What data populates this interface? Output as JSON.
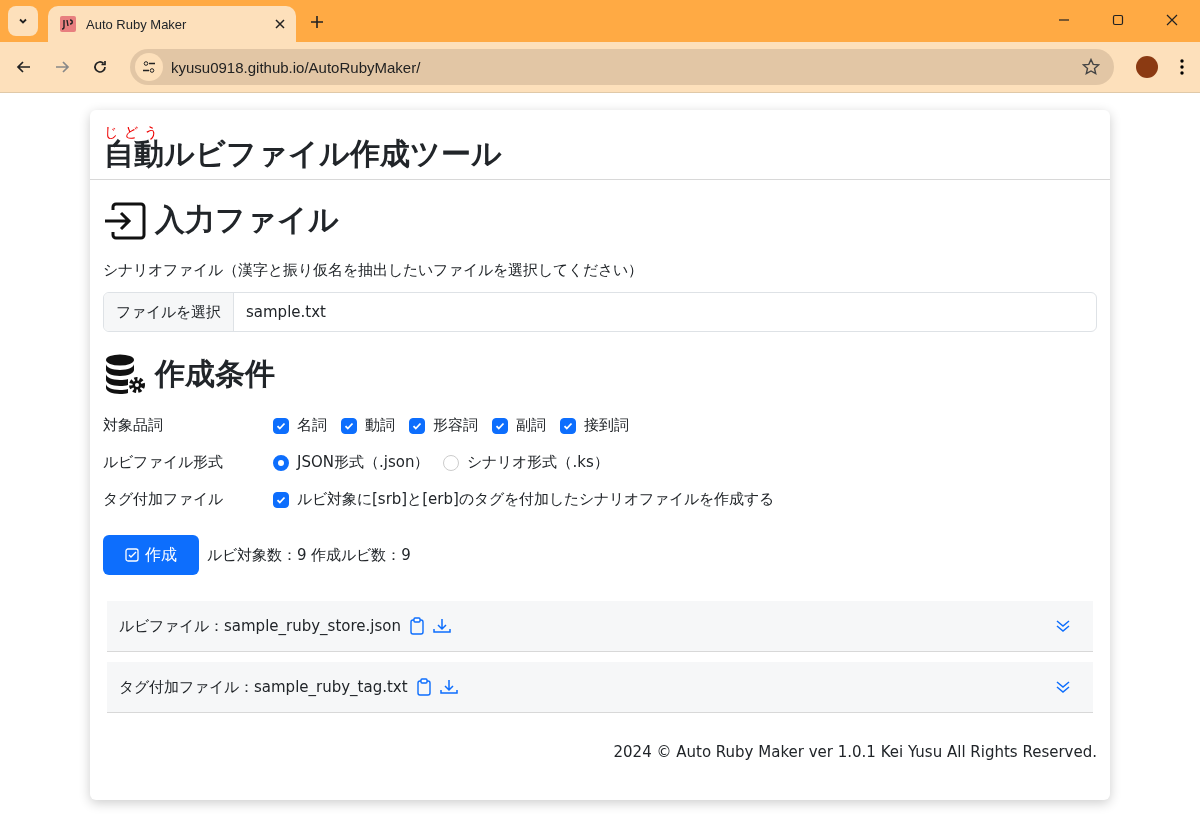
{
  "browser": {
    "tab": {
      "title": "Auto Ruby Maker",
      "selected": true
    },
    "url": "kyusu0918.github.io/AutoRubyMaker/"
  },
  "page": {
    "title": {
      "ruby_base": "自動",
      "ruby_reading": "じどう",
      "rest": "ルビファイル作成ツール"
    },
    "input_section": {
      "heading": "入力ファイル",
      "label": "シナリオファイル（漢字と振り仮名を抽出したいファイルを選択してください）",
      "file_button": "ファイルを選択",
      "file_name": "sample.txt"
    },
    "options_section": {
      "heading": "作成条件",
      "rows": [
        {
          "label": "対象品詞",
          "kind": "checkboxes",
          "options": [
            {
              "label": "名詞",
              "checked": true
            },
            {
              "label": "動詞",
              "checked": true
            },
            {
              "label": "形容詞",
              "checked": true
            },
            {
              "label": "副詞",
              "checked": true
            },
            {
              "label": "接到詞",
              "checked": true
            }
          ]
        },
        {
          "label": "ルビファイル形式",
          "kind": "radios",
          "options": [
            {
              "label": "JSON形式（.json）",
              "selected": true
            },
            {
              "label": "シナリオ形式（.ks）",
              "selected": false
            }
          ]
        },
        {
          "label": "タグ付加ファイル",
          "kind": "checkboxes",
          "options": [
            {
              "label": "ルビ対象に[srb]と[erb]のタグを付加したシナリオファイルを作成する",
              "checked": true
            }
          ]
        }
      ]
    },
    "create_button": "作成",
    "result": "ルビ対象数：9  作成ルビ数：9",
    "outputs": [
      {
        "label": "ルビファイル：sample_ruby_store.json",
        "expanded": false
      },
      {
        "label": "タグ付加ファイル：sample_ruby_tag.txt",
        "expanded": false
      }
    ],
    "footer": "2024 © Auto Ruby Maker ver 1.0.1 Kei Yusu All Rights Reserved."
  }
}
